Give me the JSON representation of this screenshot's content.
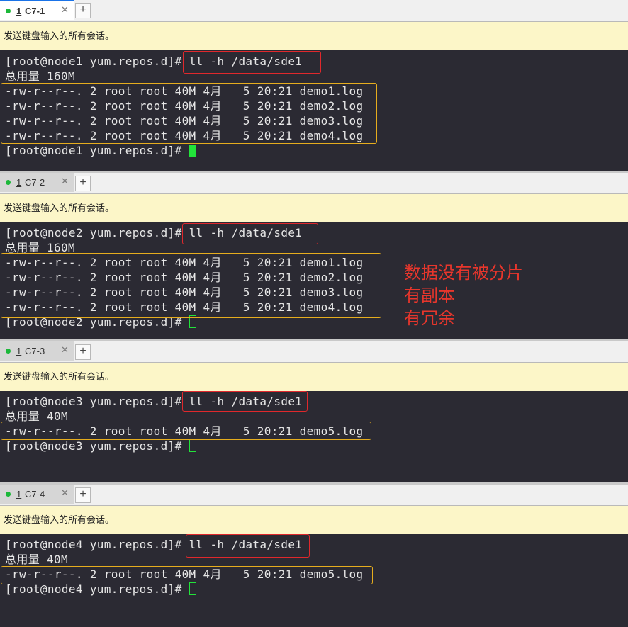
{
  "notice": "发送键盘输入的所有会话。",
  "add_tab_label": "+",
  "close_label": "✕",
  "panes": [
    {
      "tab_num": "1",
      "tab_name": "C7-1",
      "prompt": "[root@node1 yum.repos.d]#",
      "command": "ll -h /data/sde1",
      "total": "总用量 160M",
      "files": [
        "-rw-r--r--. 2 root root 40M 4月   5 20:21 demo1.log",
        "-rw-r--r--. 2 root root 40M 4月   5 20:21 demo2.log",
        "-rw-r--r--. 2 root root 40M 4月   5 20:21 demo3.log",
        "-rw-r--r--. 2 root root 40M 4月   5 20:21 demo4.log"
      ]
    },
    {
      "tab_num": "1",
      "tab_name": "C7-2",
      "prompt": "[root@node2 yum.repos.d]#",
      "command": "ll -h /data/sde1",
      "total": "总用量 160M",
      "files": [
        "-rw-r--r--. 2 root root 40M 4月   5 20:21 demo1.log",
        "-rw-r--r--. 2 root root 40M 4月   5 20:21 demo2.log",
        "-rw-r--r--. 2 root root 40M 4月   5 20:21 demo3.log",
        "-rw-r--r--. 2 root root 40M 4月   5 20:21 demo4.log"
      ]
    },
    {
      "tab_num": "1",
      "tab_name": "C7-3",
      "prompt": "[root@node3 yum.repos.d]#",
      "command": "ll -h /data/sde1",
      "total": "总用量 40M",
      "files": [
        "-rw-r--r--. 2 root root 40M 4月   5 20:21 demo5.log"
      ]
    },
    {
      "tab_num": "1",
      "tab_name": "C7-4",
      "prompt": "[root@node4 yum.repos.d]#",
      "command": "ll -h /data/sde1",
      "total": "总用量 40M",
      "files": [
        "-rw-r--r--. 2 root root 40M 4月   5 20:21 demo5.log"
      ]
    }
  ],
  "annotation": [
    "数据没有被分片",
    "有副本",
    "有冗余"
  ],
  "colors": {
    "terminal_bg": "#2b2a33",
    "notice_bg": "#fcf6c8",
    "highlight_red": "#e0282c",
    "highlight_yellow": "#e6ad1e",
    "cursor": "#22e33a",
    "status_dot": "#1cb83a"
  }
}
